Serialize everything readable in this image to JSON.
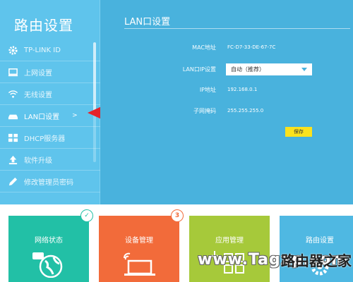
{
  "sidebar": {
    "title": "路由设置",
    "items": [
      {
        "label": "TP-LINK ID",
        "icon": "gear-icon"
      },
      {
        "label": "上网设置",
        "icon": "monitor-icon"
      },
      {
        "label": "无线设置",
        "icon": "wifi-icon"
      },
      {
        "label": "LAN口设置",
        "icon": "router-icon",
        "chevron": ">"
      },
      {
        "label": "DHCP服务器",
        "icon": "dhcp-icon"
      },
      {
        "label": "软件升级",
        "icon": "upload-icon"
      },
      {
        "label": "修改管理员密码",
        "icon": "pencil-icon"
      }
    ]
  },
  "panel": {
    "title": "LAN口设置",
    "mac_label": "MAC地址",
    "mac_value": "FC-D7-33-DE-67-7C",
    "ipmode_label": "LAN口IP设置",
    "ipmode_value": "自动（推荐）",
    "ip_label": "IP地址",
    "ip_value": "192.168.0.1",
    "mask_label": "子网掩码",
    "mask_value": "255.255.255.0",
    "save_label": "保存"
  },
  "tiles": [
    {
      "label": "网络状态",
      "color": "#22c0a6",
      "badge": "✓"
    },
    {
      "label": "设备管理",
      "color": "#f26b3a",
      "badge": "3"
    },
    {
      "label": "应用管理",
      "color": "#a6c93a"
    },
    {
      "label": "路由设置",
      "color": "#4fb8e2"
    }
  ],
  "watermark": {
    "latin": "www.Tagxp.com",
    "cn": "路由器之家"
  },
  "colors": {
    "accent": "#4fb8e2",
    "save": "#fbe21d",
    "arrow": "#e5232a"
  }
}
